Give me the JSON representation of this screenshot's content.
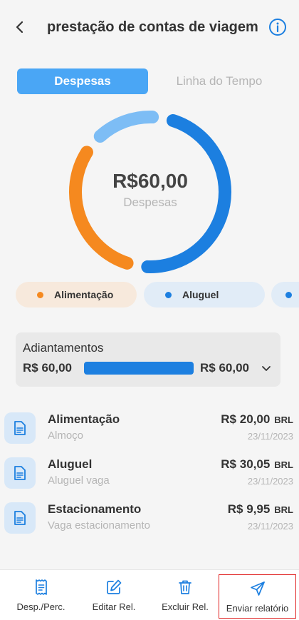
{
  "header": {
    "title": "prestação de contas de viagem",
    "back_icon": "chevron-left-icon",
    "info_icon": "info-icon"
  },
  "tabs": [
    {
      "label": "Despesas",
      "active": true
    },
    {
      "label": "Linha do Tempo",
      "active": false
    }
  ],
  "summary": {
    "amount": "R$60,00",
    "label": "Despesas"
  },
  "chart_data": {
    "type": "pie",
    "categories": [
      "Alimentação",
      "Aluguel",
      "Estacionamento"
    ],
    "values": [
      20.0,
      30.05,
      9.95
    ],
    "colors": [
      "#f5891f",
      "#1c7fe0",
      "#7dbdf5"
    ]
  },
  "chips": [
    {
      "label": "Alimentação",
      "dot_color": "#f5891f",
      "bg": "#f7e9dc"
    },
    {
      "label": "Aluguel",
      "dot_color": "#1c7fe0",
      "bg": "#e1ecf7"
    },
    {
      "label": "",
      "dot_color": "#1c7fe0",
      "bg": "#e1ecf7"
    }
  ],
  "advances": {
    "title": "Adiantamentos",
    "left_value": "R$ 60,00",
    "right_value": "R$ 60,00",
    "progress": 1.0,
    "bar_color": "#1c7fe0"
  },
  "expenses": [
    {
      "name": "Alimentação",
      "description": "Almoço",
      "amount": "R$ 20,00",
      "currency": "BRL",
      "date": "23/11/2023"
    },
    {
      "name": "Aluguel",
      "description": "Aluguel vaga",
      "amount": "R$ 30,05",
      "currency": "BRL",
      "date": "23/11/2023"
    },
    {
      "name": "Estacionamento",
      "description": "Vaga estacionamento",
      "amount": "R$ 9,95",
      "currency": "BRL",
      "date": "23/11/2023"
    }
  ],
  "bottom_nav": [
    {
      "label": "Desp./Perc.",
      "icon": "receipt-icon"
    },
    {
      "label": "Editar Rel.",
      "icon": "edit-icon"
    },
    {
      "label": "Excluir Rel.",
      "icon": "trash-icon"
    },
    {
      "label": "Enviar relatório",
      "icon": "send-icon",
      "highlighted": true
    }
  ]
}
